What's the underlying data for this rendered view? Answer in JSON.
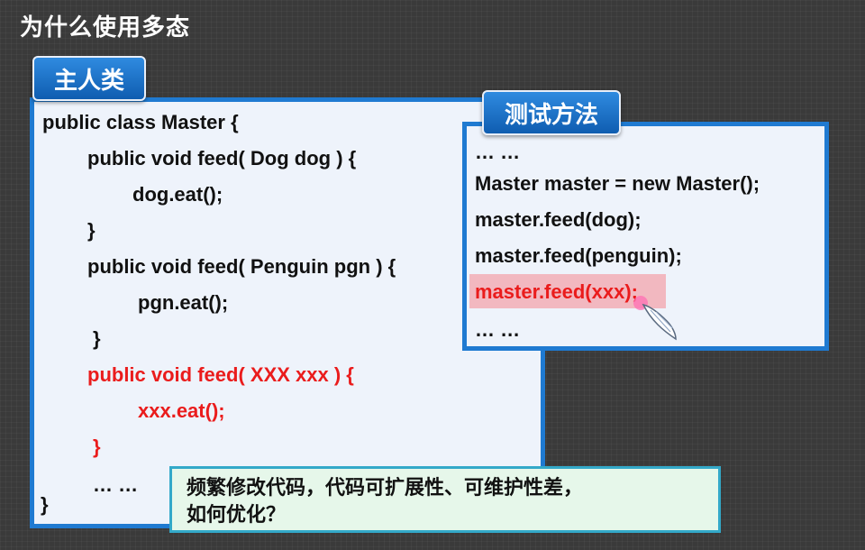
{
  "slide": {
    "title": "为什么使用多态"
  },
  "left_panel": {
    "tag": "主人类",
    "lines": [
      "public class Master {",
      "public void feed( Dog dog ) {",
      "dog.eat();",
      "}",
      "public void feed( Penguin pgn ) {",
      "pgn.eat();",
      "}",
      "public void feed( XXX xxx ) {",
      "xxx.eat();",
      "}",
      "… …",
      "}"
    ]
  },
  "right_panel": {
    "tag": "测试方法",
    "lines": [
      "… …",
      "Master master = new Master();",
      "master.feed(dog);",
      "master.feed(penguin);",
      "master.feed(xxx);",
      "… …"
    ]
  },
  "note": {
    "line1": "频繁修改代码，代码可扩展性、可维护性差，",
    "line2": "如何优化？"
  },
  "colors": {
    "panel_border": "#1f7ad1",
    "panel_bg": "#eef3fb",
    "highlight_text": "#ea1c1c",
    "highlight_bg": "#f2b8c0",
    "note_bg": "#e6f7ea",
    "note_border": "#33a9c9"
  },
  "icons": {
    "cursor": "pointer-hand-icon"
  }
}
